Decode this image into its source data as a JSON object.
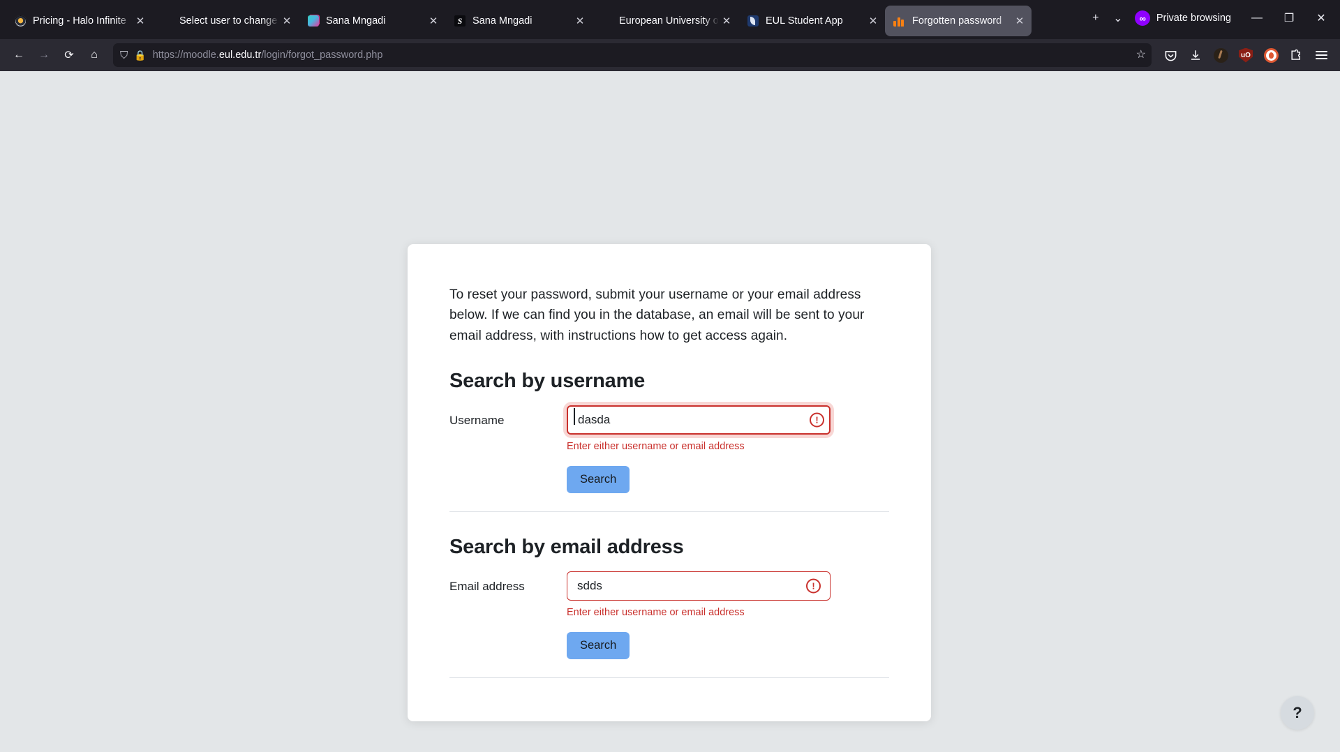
{
  "browser": {
    "tabs": [
      {
        "title": "Pricing - Halo Infinite",
        "favicon": "halo-icon",
        "active": false
      },
      {
        "title": "Select user to change | P",
        "favicon": "none",
        "active": false
      },
      {
        "title": "Sana Mngadi",
        "favicon": "gradient-squares-icon",
        "active": false
      },
      {
        "title": "Sana Mngadi",
        "favicon": "letter-s-icon",
        "active": false
      },
      {
        "title": "European University of L",
        "favicon": "none",
        "active": false
      },
      {
        "title": "EUL Student App",
        "favicon": "eul-icon",
        "active": false
      },
      {
        "title": "Forgotten password",
        "favicon": "moodle-icon",
        "active": true
      }
    ],
    "new_tab_label": "+",
    "tab_list_label": "⌄",
    "private_browsing_label": "Private browsing",
    "window_controls": {
      "minimize": "—",
      "maximize": "❐",
      "close": "✕"
    },
    "nav": {
      "back": "←",
      "forward": "→",
      "reload": "⟳",
      "home": "⌂"
    },
    "url": {
      "scheme": "https://moodle.",
      "domain": "eul.edu.tr",
      "path": "/login/forgot_password.php"
    },
    "toolbar_icons": [
      "pocket-icon",
      "download-icon",
      "account-avatar-icon",
      "ublock-origin-icon",
      "duckduckgo-icon",
      "extensions-puzzle-icon",
      "app-menu-icon"
    ],
    "ublock_label": "uO"
  },
  "page": {
    "intro": "To reset your password, submit your username or your email address below. If we can find you in the database, an email will be sent to your email address, with instructions how to get access again.",
    "username_section": {
      "heading": "Search by username",
      "label": "Username",
      "value": "dasda",
      "placeholder": "",
      "error": "Enter either username or email address",
      "button": "Search"
    },
    "email_section": {
      "heading": "Search by email address",
      "label": "Email address",
      "value": "sdds",
      "placeholder": "",
      "error": "Enter either username or email address",
      "button": "Search"
    },
    "help_button": "?"
  },
  "colors": {
    "chrome_bg": "#1c1b22",
    "navbar_bg": "#2b2a33",
    "page_bg": "#e3e6e8",
    "card_bg": "#ffffff",
    "error_red": "#c9302c",
    "error_halo": "#f8d7d5",
    "button_blue": "#6ea8f0",
    "private_purple": "#8f00ff"
  }
}
